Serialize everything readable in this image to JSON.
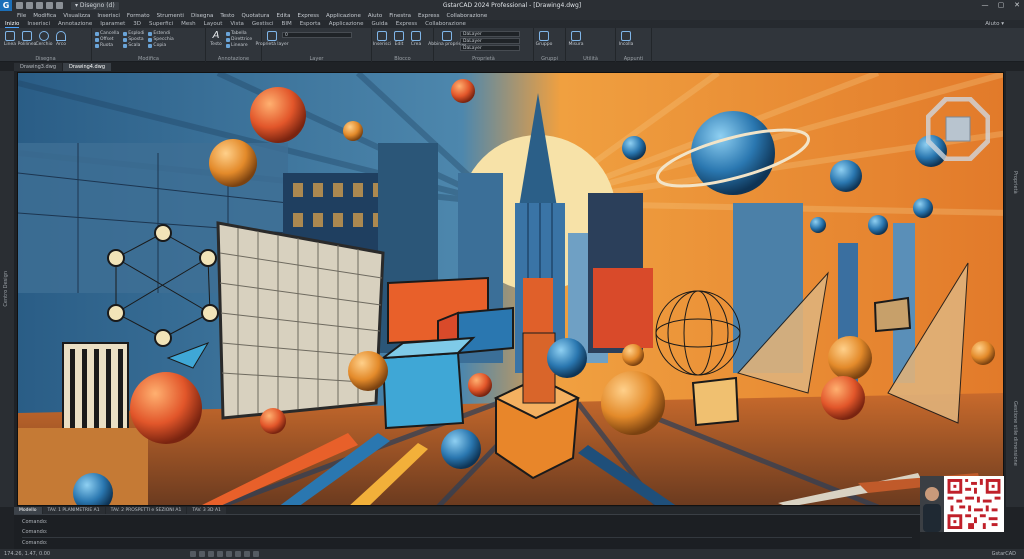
{
  "titlebar": {
    "logo_letter": "G",
    "drawing_select": "▾ Disegno (d)",
    "title": "GstarCAD 2024 Professional - [Drawing4.dwg]",
    "minimize": "—",
    "maximize": "▢",
    "close": "✕"
  },
  "menu": [
    "File",
    "Modifica",
    "Visualizza",
    "Inserisci",
    "Formato",
    "Strumenti",
    "Disegna",
    "Testo",
    "Quotatura",
    "Edita",
    "Express",
    "Applicazione",
    "Aiuto",
    "Finestra",
    "Express",
    "Collaborazione"
  ],
  "ribbon_tabs": [
    "Inizio",
    "Inserisci",
    "Annotazione",
    "Iparamet",
    "3D",
    "Superfici",
    "Mesh",
    "Layout",
    "Vista",
    "Gestisci",
    "BIM",
    "Esporta",
    "Applicazione",
    "Guida",
    "Express",
    "Collaborazione"
  ],
  "ribbon_right": "Aiuto ▾",
  "ribbon": {
    "draw": {
      "label": "Disegna",
      "tools": [
        "Linea",
        "Polilinea",
        "Cerchio",
        "Arco"
      ]
    },
    "modify": {
      "label": "Modifica",
      "tools": [
        "Cancella",
        "Esplodi",
        "Estendi",
        "Offset",
        "Sposta",
        "Specchia",
        "Ruota",
        "Scala",
        "Copia"
      ]
    },
    "annotation": {
      "label": "Annotazione",
      "tools": [
        "Testo",
        "Tabella",
        "Direttrice",
        "Lineare"
      ]
    },
    "layers": {
      "label": "Layer",
      "tools": [
        "Proprietà layer"
      ],
      "combo": "0"
    },
    "block": {
      "label": "Blocco",
      "tools": [
        "Inserisci",
        "Edit",
        "Crea"
      ]
    },
    "properties": {
      "label": "Proprietà",
      "tools": [
        "Abbina proprietà"
      ],
      "combos": [
        "DaLayer",
        "DaLayer",
        "DaLayer"
      ]
    },
    "groups": {
      "label": "Gruppi",
      "tools": [
        "Gruppo"
      ]
    },
    "utilities": {
      "label": "Utilità",
      "tools": [
        "Misura"
      ]
    },
    "clipboard": {
      "label": "Appunti",
      "tools": [
        "Incolla"
      ]
    }
  },
  "doc_tabs": [
    "Drawing3.dwg",
    "Drawing4.dwg"
  ],
  "left_strip_label": "Centro Design",
  "right_strip_labels": [
    "Proprietà",
    "Gestione stile dimensione"
  ],
  "layout_tabs": [
    "Modello",
    "TAV. 1 PLANIMETRIE A1",
    "TAV. 2 PROSPETTI e SEZIONI A1",
    "TAV. 3 3D A1"
  ],
  "cmdline": {
    "history": [
      "Comando:",
      "Comando:",
      "Comando:"
    ],
    "prompt": "Comando:"
  },
  "status": {
    "coords": "174.26, 1.47, 0.00",
    "right": "GstarCAD"
  },
  "colors": {
    "accent": "#4aa3ff",
    "canvas_orange": "#e58a35",
    "canvas_blue": "#2f6d9c",
    "ui_dark": "#2b2f34"
  }
}
